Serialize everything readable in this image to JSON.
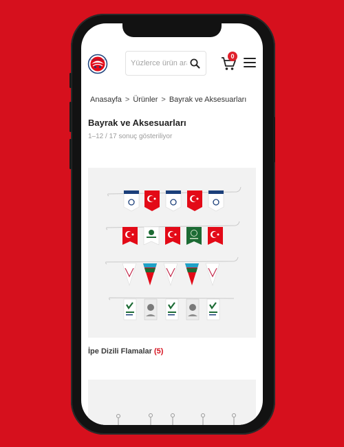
{
  "header": {
    "search_placeholder": "Yüzlerce ürün arayın",
    "cart_count": "0"
  },
  "breadcrumb": {
    "items": [
      "Anasayfa",
      "Ürünler",
      "Bayrak ve Aksesuarları"
    ],
    "separator": ">"
  },
  "page": {
    "title": "Bayrak ve Aksesuarları",
    "result_count": "1–12 / 17 sonuç gösteriliyor"
  },
  "products": [
    {
      "name": "İpe Dizili Flamalar",
      "count": "(5)"
    }
  ],
  "colors": {
    "background": "#d6101d",
    "accent": "#e0202b",
    "flag_red": "#e30a17",
    "flag_navy": "#1b3f7a",
    "flag_green": "#1c6b34"
  }
}
